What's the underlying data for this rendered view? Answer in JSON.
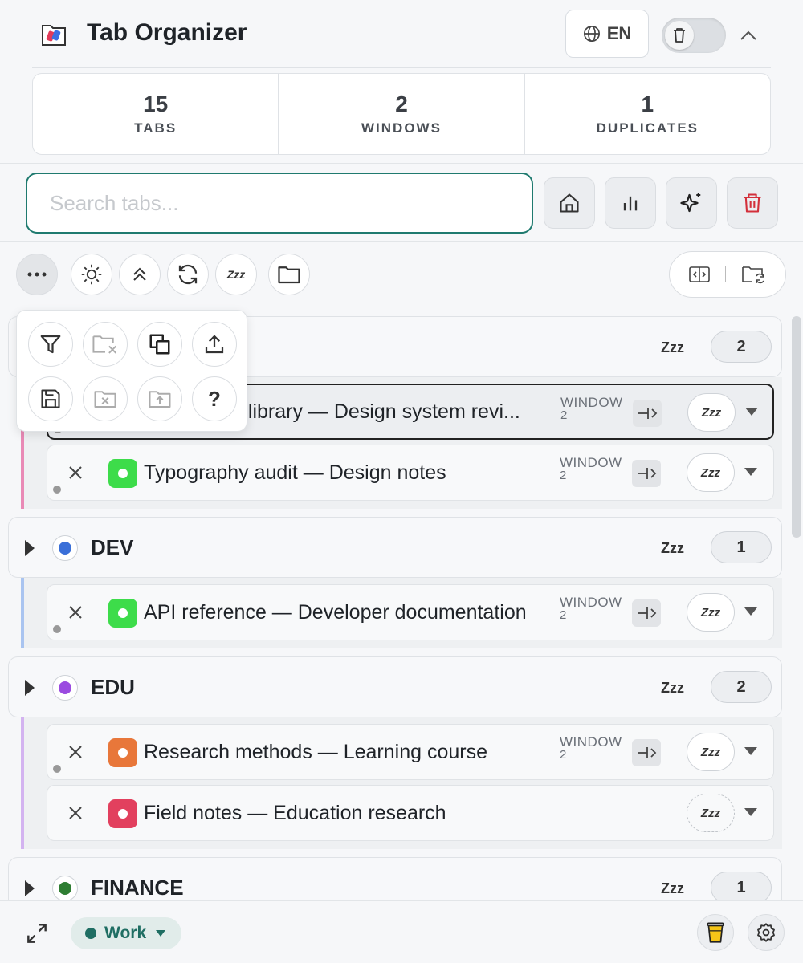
{
  "header": {
    "title": "Tab Organizer",
    "language": "EN",
    "stats": [
      {
        "value": "15",
        "label": "TABS"
      },
      {
        "value": "2",
        "label": "WINDOWS"
      },
      {
        "value": "1",
        "label": "DUPLICATES"
      }
    ]
  },
  "search": {
    "placeholder": "Search tabs..."
  },
  "toolbar": {
    "snooze_label": "Zzz"
  },
  "groups": [
    {
      "name": "",
      "color": "#e98ab6",
      "zzz": "Zzz",
      "count": "2",
      "tabs": [
        {
          "title": "t library — Design system revi...",
          "window_label": "WINDOW",
          "window_num": "2",
          "favicon_color": "#3ddc4a",
          "zzz": "Zzz"
        },
        {
          "title": "Typography audit — Design notes",
          "window_label": "WINDOW",
          "window_num": "2",
          "favicon_color": "#3ddc4a",
          "zzz": "Zzz"
        }
      ]
    },
    {
      "name": "DEV",
      "color": "#3a6fd8",
      "zzz": "Zzz",
      "count": "1",
      "tabs": [
        {
          "title": "API reference — Developer documentation",
          "window_label": "WINDOW",
          "window_num": "2",
          "favicon_color": "#3ddc4a",
          "zzz": "Zzz"
        }
      ]
    },
    {
      "name": "EDU",
      "color": "#9b4be0",
      "zzz": "Zzz",
      "count": "2",
      "tabs": [
        {
          "title": "Research methods — Learning course",
          "window_label": "WINDOW",
          "window_num": "2",
          "favicon_color": "#e8773a",
          "zzz": "Zzz"
        },
        {
          "title": "Field notes — Education research",
          "favicon_color": "#e2405e",
          "zzz": "Zzz"
        }
      ]
    },
    {
      "name": "FINANCE",
      "color": "#2e7d32",
      "zzz": "Zzz",
      "count": "1"
    }
  ],
  "popover": {
    "help": "?"
  },
  "footer": {
    "workspace": "Work"
  },
  "colors": {
    "accent": "#1f7a6f",
    "danger": "#d32f3a"
  }
}
